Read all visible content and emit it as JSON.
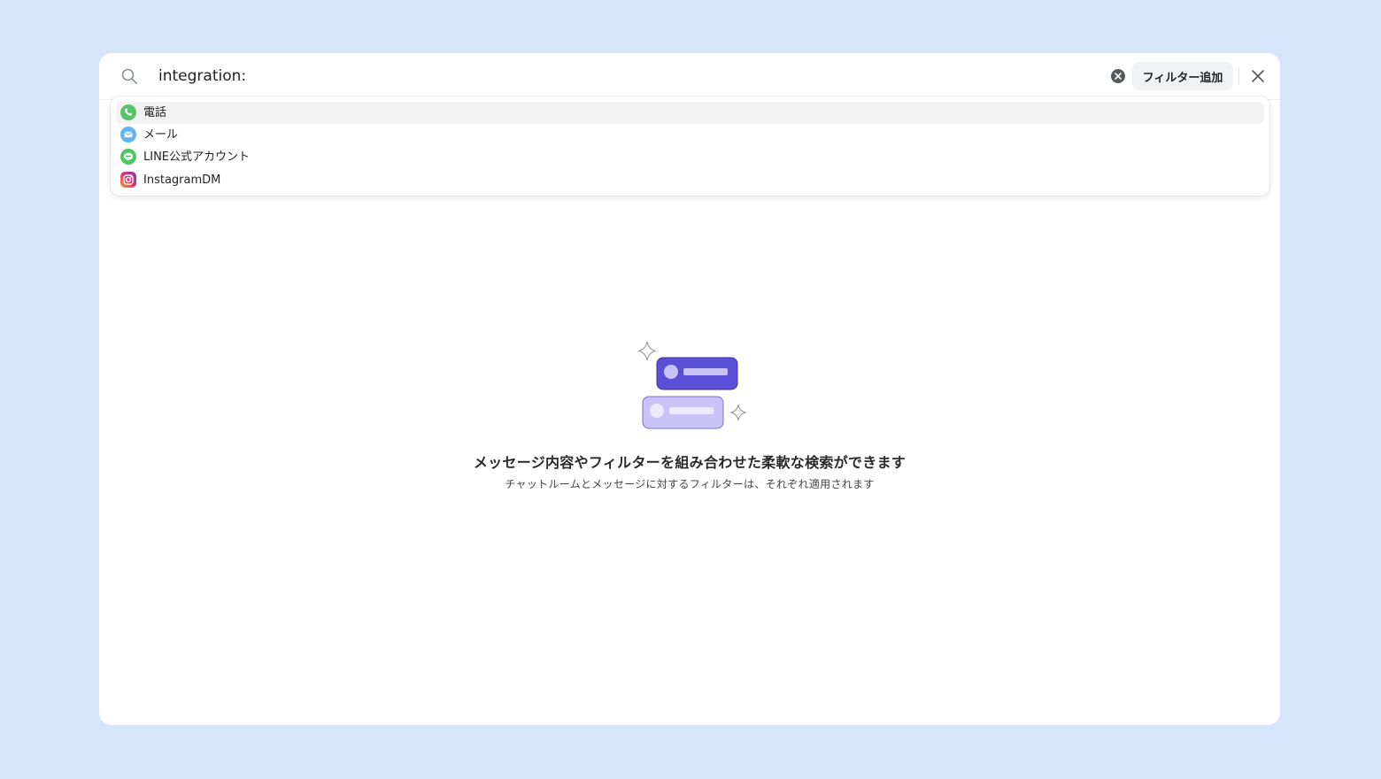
{
  "search": {
    "value": "integration:",
    "filter_button_label": "フィルター追加"
  },
  "dropdown": {
    "items": [
      {
        "label": "電話",
        "icon": "phone-icon",
        "color": "#5ac26a"
      },
      {
        "label": "メール",
        "icon": "mail-icon",
        "color": "#5fb3f0"
      },
      {
        "label": "LINE公式アカウント",
        "icon": "line-icon",
        "color": "#4cc764"
      },
      {
        "label": "InstagramDM",
        "icon": "instagram-icon",
        "color": "#d6287a"
      }
    ]
  },
  "empty_state": {
    "title": "メッセージ内容やフィルターを組み合わせた柔軟な検索ができます",
    "subtitle": "チャットルームとメッセージに対するフィルターは、それぞれ適用されます"
  },
  "colors": {
    "background": "#d7e5fc",
    "accent": "#5b4fd6",
    "accent_light": "#c9c3f7"
  }
}
